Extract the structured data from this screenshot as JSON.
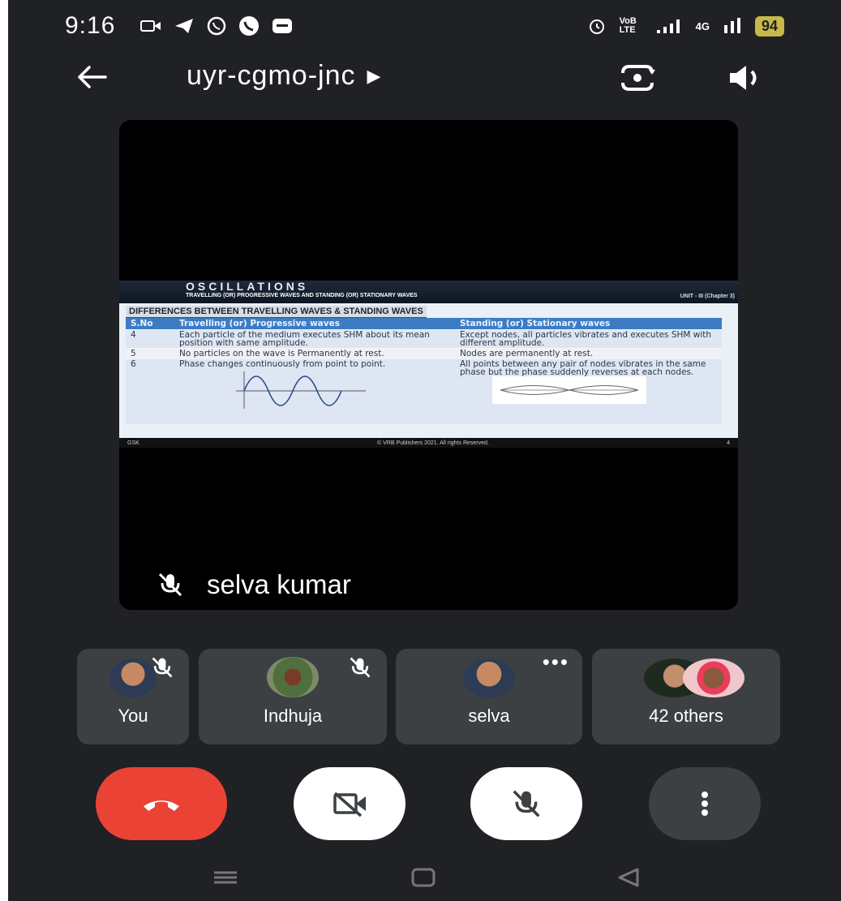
{
  "status_bar": {
    "time": "9:16",
    "right_text": "VoB LTE",
    "network": "4G",
    "battery": "94"
  },
  "header": {
    "title": "uyr-cgmo-jnc"
  },
  "slide": {
    "chapter": "OSCILLATIONS",
    "subtitle": "TRAVELLING (OR) PROGRESSIVE WAVES AND STANDING (OR) STATIONARY WAVES",
    "unit": "UNIT - III (Chapter 3)",
    "heading": "DIFFERENCES BETWEEN TRAVELLING WAVES & STANDING WAVES",
    "columns": [
      "S.No",
      "Travelling (or) Progressive waves",
      "Standing (or) Stationary waves"
    ],
    "rows": [
      {
        "sno": "4",
        "travelling": "Each particle of the medium executes SHM about its mean position with same amplitude.",
        "standing": "Except nodes, all particles vibrates and executes SHM with different amplitude."
      },
      {
        "sno": "5",
        "travelling": "No particles on the wave is Permanently at rest.",
        "standing": "Nodes are permanently at rest."
      },
      {
        "sno": "6",
        "travelling": "Phase changes continuously from point to point.",
        "standing": "All points between any pair of nodes vibrates in the same phase but the phase suddenly reverses at each nodes."
      }
    ],
    "footer_left": "GSK",
    "footer_center": "© VRB Publishers 2021. All rights Reserved.",
    "footer_right": "4"
  },
  "stage": {
    "speaker": "selva kumar"
  },
  "participants": [
    {
      "name": "You"
    },
    {
      "name": "Indhuja"
    },
    {
      "name": "selva"
    },
    {
      "name": "42 others"
    }
  ],
  "colors": {
    "end_call": "#ea4335",
    "tile": "#3c4043",
    "background": "#202124"
  }
}
